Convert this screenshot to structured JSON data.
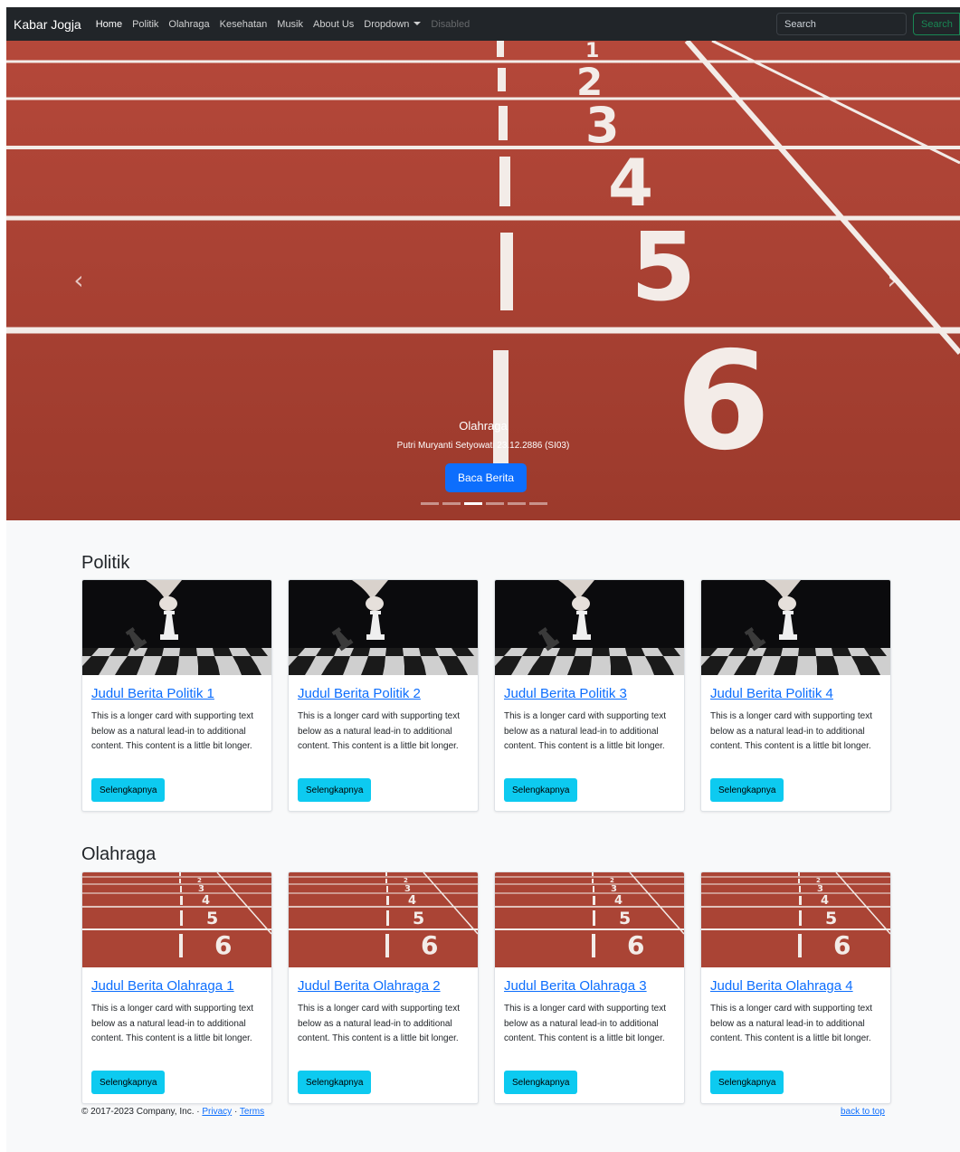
{
  "navbar": {
    "brand": "Kabar Jogja",
    "links": [
      "Home",
      "Politik",
      "Olahraga",
      "Kesehatan",
      "Musik",
      "About Us",
      "Dropdown",
      "Disabled"
    ],
    "search_placeholder": "Search",
    "search_button": "Search"
  },
  "carousel": {
    "title": "Olahraga",
    "subtitle": "Putri Muryanti Setyowati 23.12.2886 (SI03)",
    "button": "Baca Berita",
    "prev_icon": "chevron-left-icon",
    "next_icon": "chevron-right-icon",
    "active_slide": 3,
    "slide_count": 6
  },
  "sections": [
    {
      "title": "Politik",
      "cards": [
        {
          "title": "Judul Berita Politik 1",
          "text": "This is a longer card with supporting text below as a natural lead-in to additional content. This content is a little bit longer.",
          "button": "Selengkapnya"
        },
        {
          "title": "Judul Berita Politik 2",
          "text": "This is a longer card with supporting text below as a natural lead-in to additional content. This content is a little bit longer.",
          "button": "Selengkapnya"
        },
        {
          "title": "Judul Berita Politik 3",
          "text": "This is a longer card with supporting text below as a natural lead-in to additional content. This content is a little bit longer.",
          "button": "Selengkapnya"
        },
        {
          "title": "Judul Berita Politik 4",
          "text": "This is a longer card with supporting text below as a natural lead-in to additional content. This content is a little bit longer.",
          "button": "Selengkapnya"
        }
      ]
    },
    {
      "title": "Olahraga",
      "cards": [
        {
          "title": "Judul Berita Olahraga 1",
          "text": "This is a longer card with supporting text below as a natural lead-in to additional content. This content is a little bit longer.",
          "button": "Selengkapnya"
        },
        {
          "title": "Judul Berita Olahraga 2",
          "text": "This is a longer card with supporting text below as a natural lead-in to additional content. This content is a little bit longer.",
          "button": "Selengkapnya"
        },
        {
          "title": "Judul Berita Olahraga 3",
          "text": "This is a longer card with supporting text below as a natural lead-in to additional content. This content is a little bit longer.",
          "button": "Selengkapnya"
        },
        {
          "title": "Judul Berita Olahraga 4",
          "text": "This is a longer card with supporting text below as a natural lead-in to additional content. This content is a little bit longer.",
          "button": "Selengkapnya"
        }
      ]
    }
  ],
  "footer": {
    "copyright": "© 2017-2023 Company, Inc. · ",
    "privacy": "Privacy",
    "separator": " · ",
    "terms": "Terms",
    "back_to_top": "back to top"
  },
  "colors": {
    "navbar": "#212529",
    "primary": "#0d6efd",
    "info_button": "#0dcaf0",
    "search_outline": "#198754",
    "track": "#a84030",
    "page_bg": "#f8f9fa"
  }
}
